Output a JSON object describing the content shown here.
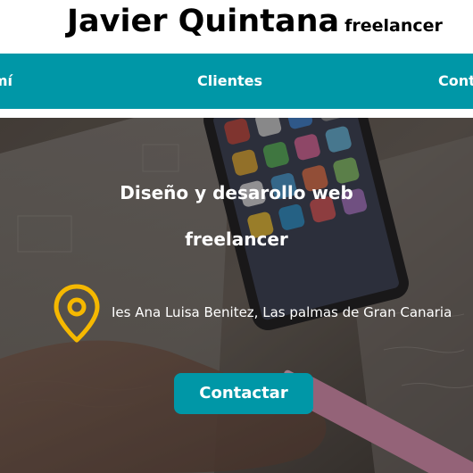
{
  "header": {
    "name": "Javier Quintana",
    "role": "freelancer"
  },
  "nav": {
    "items": [
      {
        "label": "Sobre mí"
      },
      {
        "label": "Clientes"
      },
      {
        "label": "Contacto"
      }
    ],
    "about_visible": "mí",
    "contact_visible": "Conta"
  },
  "hero": {
    "title_line1": "Diseño y desarollo web",
    "title_line2": "freelancer",
    "location_icon": "map-pin-icon",
    "location": "Ies Ana Luisa Benitez, Las palmas de Gran Canaria",
    "button_label": "Contactar"
  },
  "colors": {
    "accent": "#0097a7",
    "pin": "#f5b800",
    "text_on_dark": "#ffffff"
  }
}
